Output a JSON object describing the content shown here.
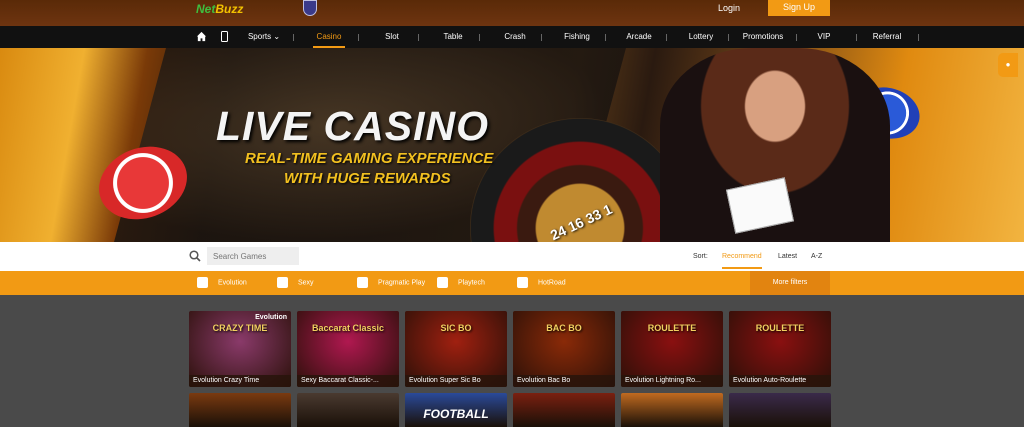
{
  "header": {
    "logo_prefix": "Net",
    "logo_suffix": "Buzz",
    "login_label": "Login",
    "signup_label": "Sign Up"
  },
  "nav": {
    "items": [
      {
        "label": "Sports ⌄"
      },
      {
        "label": "Casino",
        "active": true
      },
      {
        "label": "Slot"
      },
      {
        "label": "Table"
      },
      {
        "label": "Crash"
      },
      {
        "label": "Fishing"
      },
      {
        "label": "Arcade"
      },
      {
        "label": "Lottery"
      },
      {
        "label": "Promotions"
      },
      {
        "label": "VIP"
      },
      {
        "label": "Referral"
      }
    ]
  },
  "banner": {
    "title": "LIVE CASINO",
    "subtitle_line1": "REAL-TIME GAMING EXPERIENCE",
    "subtitle_line2": "WITH HUGE REWARDS",
    "wheel_numbers": "24 16 33 1"
  },
  "search": {
    "placeholder": "Search Games",
    "sort_label": "Sort:",
    "sort_options": [
      "Recommend",
      "Latest",
      "A-Z"
    ],
    "active_sort": "Recommend"
  },
  "filters": {
    "providers": [
      "Evolution",
      "Sexy",
      "Pragmatic Play",
      "Playtech",
      "HotRoad"
    ],
    "more_label": "More filters"
  },
  "games": [
    {
      "name": "Evolution Crazy Time",
      "brand": "Evolution",
      "art": "CRAZY TIME",
      "color": "#8a3a6a"
    },
    {
      "name": "Sexy Baccarat Classic-...",
      "brand": "",
      "art": "Baccarat Classic",
      "color": "#b01850"
    },
    {
      "name": "Evolution Super Sic Bo",
      "brand": "",
      "art": "SIC BO",
      "color": "#a02010"
    },
    {
      "name": "Evolution Bac Bo",
      "brand": "",
      "art": "BAC BO",
      "color": "#8a2a08"
    },
    {
      "name": "Evolution Lightning Ro...",
      "brand": "",
      "art": "ROULETTE",
      "color": "#8a1010"
    },
    {
      "name": "Evolution Auto-Roulette",
      "brand": "",
      "art": "ROULETTE",
      "color": "#8a1010"
    }
  ],
  "second_row_art": [
    "",
    "",
    "FOOTBALL",
    "",
    "",
    ""
  ],
  "side_tab_icon": "chat-icon",
  "colors": {
    "accent": "#f29a14",
    "nav_bg": "#111111",
    "page_bg": "#4a4a4a"
  }
}
